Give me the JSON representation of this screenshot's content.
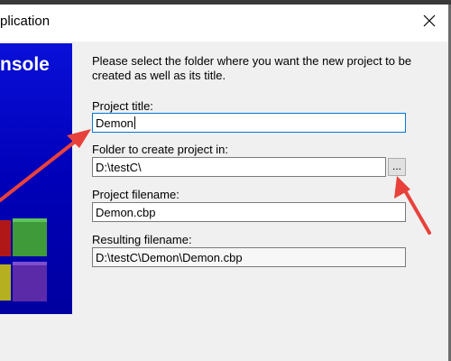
{
  "window": {
    "title": "plication",
    "close_icon": "close-icon"
  },
  "banner": {
    "text": "nsole",
    "colors": {
      "background": "#0000c8",
      "text": "#ffffff"
    }
  },
  "description": "Please select the folder where you want the new project to be created as well as its title.",
  "fields": {
    "project_title": {
      "label": "Project title:",
      "value": "Demon"
    },
    "folder": {
      "label": "Folder to create project in:",
      "value": "D:\\testC\\"
    },
    "project_filename": {
      "label": "Project filename:",
      "value": "Demon.cbp"
    },
    "resulting_filename": {
      "label": "Resulting filename:",
      "value": "D:\\testC\\Demon\\Demon.cbp"
    }
  },
  "browse_button": {
    "label": "..."
  },
  "annotation": {
    "arrow_color": "#e8413c"
  }
}
